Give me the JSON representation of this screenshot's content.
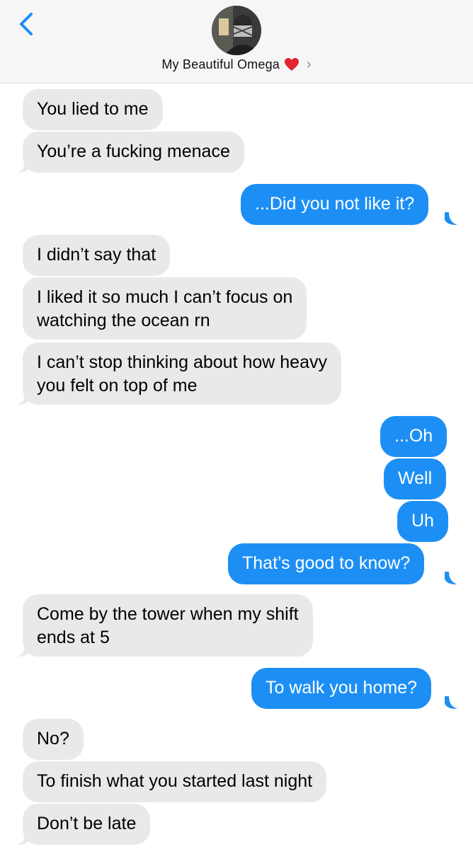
{
  "header": {
    "contact_name": "My Beautiful Omega",
    "emoji": "❤️",
    "chevron": "›",
    "back_icon": "chevron-left-icon",
    "accent": "#1d8ff4"
  },
  "messages": [
    {
      "from": "them",
      "text": "You lied to me"
    },
    {
      "from": "them",
      "text": "You’re a fucking menace"
    },
    {
      "from": "me",
      "text": "...Did you not like it?"
    },
    {
      "from": "them",
      "text": "I didn’t say that"
    },
    {
      "from": "them",
      "text": "I liked it so much I can’t focus on\nwatching the ocean rn"
    },
    {
      "from": "them",
      "text": "I can’t stop thinking about how heavy\nyou felt on top of me"
    },
    {
      "from": "me",
      "text": "...Oh"
    },
    {
      "from": "me",
      "text": "Well"
    },
    {
      "from": "me",
      "text": "Uh"
    },
    {
      "from": "me",
      "text": "That’s good to know?"
    },
    {
      "from": "them",
      "text": "Come by the tower when my shift\nends at 5"
    },
    {
      "from": "me",
      "text": "To walk you home?"
    },
    {
      "from": "them",
      "text": "No?"
    },
    {
      "from": "them",
      "text": "To finish what you started last night"
    },
    {
      "from": "them",
      "text": "Don’t be late"
    }
  ]
}
